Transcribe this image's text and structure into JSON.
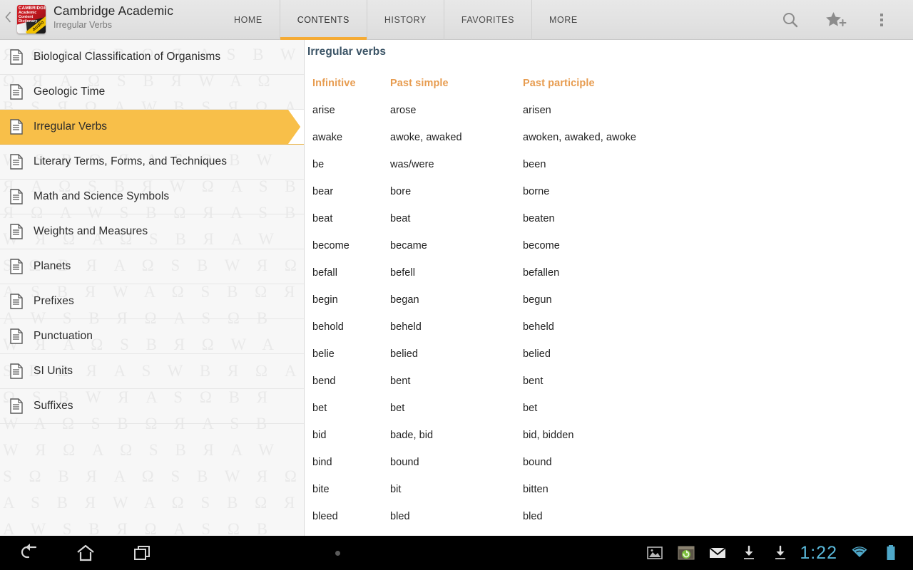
{
  "header": {
    "back_icon": "chevron-left-icon",
    "app_icon": {
      "line1": "CAMBRIDGE",
      "line2": "Academic",
      "line3": "Content",
      "line4": "Dictionary",
      "ribbon": "audio"
    },
    "title": "Cambridge Academic",
    "subtitle": "Irregular Verbs",
    "tabs": [
      {
        "label": "HOME",
        "active": false
      },
      {
        "label": "CONTENTS",
        "active": true
      },
      {
        "label": "HISTORY",
        "active": false
      },
      {
        "label": "FAVORITES",
        "active": false
      },
      {
        "label": "MORE",
        "active": false
      }
    ],
    "actions": [
      {
        "name": "search-icon",
        "label": "Search"
      },
      {
        "name": "add-favorite-icon",
        "label": "Add to favorites"
      },
      {
        "name": "overflow-menu-icon",
        "label": "More options"
      }
    ],
    "accent_color": "#f5ab35",
    "bar_color": "#e4e4e4"
  },
  "sidebar": {
    "items": [
      {
        "label": "Biological Classification of Organisms",
        "selected": false
      },
      {
        "label": "Geologic Time",
        "selected": false
      },
      {
        "label": "Irregular Verbs",
        "selected": true
      },
      {
        "label": "Literary Terms, Forms, and Techniques",
        "selected": false
      },
      {
        "label": "Math and Science Symbols",
        "selected": false
      },
      {
        "label": "Weights and Measures",
        "selected": false
      },
      {
        "label": "Planets",
        "selected": false
      },
      {
        "label": "Prefixes",
        "selected": false
      },
      {
        "label": "Punctuation",
        "selected": false
      },
      {
        "label": "SI Units",
        "selected": false
      },
      {
        "label": "Suffixes",
        "selected": false
      }
    ],
    "selected_color": "#f8bf49",
    "watermark_text": "Я Ω A S B Ω Я A S B W Ω Я A Ω S B Я W A Ω B S Я Ω A W B S Я Ω A S B W Я Ω A S Ω B Я A W S B Ω Я A S Ω B W Я A Ω S B Я W Ω A S B Я Ω A W S B Ω Я A S B W Я Ω A Ω S B Я A W S Ω B Я A Ω S B W Я Ω A S B Я W A Ω S B Ω Я A W S B Я Ω A S Ω B W Я A Ω S B Я Ω W A S B Ω Я A S W B Я Ω A Ω S B W Я A S Ω B Я W A Ω S B Ω Я A S B W Я Ω A Ω S B Я A W S Ω B Я A Ω S B W Я Ω A S B Я W A Ω S B Ω Я A W S B Я Ω A S Ω B W Я A Ω S B Я Ω W A S B Ω Я A S W B Я Ω A Ω S B W Я A S Ω B Я W A Ω S B Ω Я A S B W Я Ω A Ω S B Я A W S Ω B Я A Ω S B W Я Ω A S B Я W A Ω S B Ω Я A W S B Я Ω A S Ω B W Я A Ω S B Я Ω W A S B Ω Я A S W B Я Ω A Ω S B W Я A S Ω B Я W A Ω S B Ω Я A S B W Я Ω A Ω S B Я A W S Ω B Я A Ω S B W Я Ω A S B Я W A Ω S B Ω Я A W S B Я Ω A S Ω B"
  },
  "content": {
    "title": "Irregular verbs",
    "columns": [
      "Infinitive",
      "Past simple",
      "Past participle"
    ],
    "header_color": "#e79c50",
    "title_color": "#3b5466",
    "rows": [
      [
        "arise",
        "arose",
        "arisen"
      ],
      [
        "awake",
        "awoke, awaked",
        "awoken, awaked, awoke"
      ],
      [
        "be",
        "was/were",
        "been"
      ],
      [
        "bear",
        "bore",
        "borne"
      ],
      [
        "beat",
        "beat",
        "beaten"
      ],
      [
        "become",
        "became",
        "become"
      ],
      [
        "befall",
        "befell",
        "befallen"
      ],
      [
        "begin",
        "began",
        "begun"
      ],
      [
        "behold",
        "beheld",
        "beheld"
      ],
      [
        "belie",
        "belied",
        "belied"
      ],
      [
        "bend",
        "bent",
        "bent"
      ],
      [
        "bet",
        "bet",
        "bet"
      ],
      [
        "bid",
        "bade, bid",
        "bid, bidden"
      ],
      [
        "bind",
        "bound",
        "bound"
      ],
      [
        "bite",
        "bit",
        "bitten"
      ],
      [
        "bleed",
        "bled",
        "bled"
      ]
    ]
  },
  "navbar": {
    "buttons": [
      {
        "name": "back-button",
        "label": "Back"
      },
      {
        "name": "home-button",
        "label": "Home"
      },
      {
        "name": "recent-apps-button",
        "label": "Recent apps"
      }
    ],
    "status_icons": [
      {
        "name": "gallery-icon",
        "label": "Screenshot"
      },
      {
        "name": "app-sync-icon",
        "label": "App update"
      },
      {
        "name": "email-icon",
        "label": "Email"
      },
      {
        "name": "download-icon",
        "label": "Download"
      },
      {
        "name": "download-icon-2",
        "label": "Download"
      }
    ],
    "clock": "1:22",
    "wifi_icon": "wifi-icon",
    "battery_icon": "battery-icon",
    "clock_color": "#59b7d8"
  }
}
